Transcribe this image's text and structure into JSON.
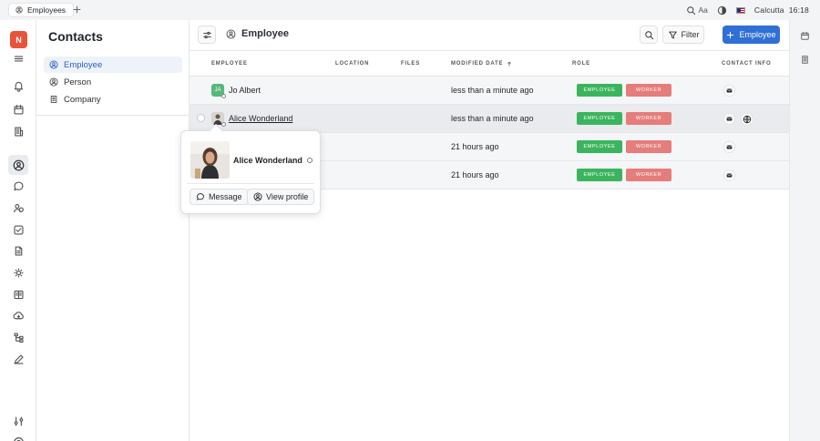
{
  "tabs": [
    {
      "label": "Employees"
    }
  ],
  "topbar": {
    "aa_label": "Aa",
    "location": "Calcutta",
    "time": "16:18"
  },
  "brand": {
    "letter": "N",
    "color": "#e8543a"
  },
  "nav": {
    "title": "Contacts",
    "items": [
      {
        "label": "Employee",
        "icon": "person-circle-icon",
        "active": true
      },
      {
        "label": "Person",
        "icon": "person-circle-icon",
        "active": false
      },
      {
        "label": "Company",
        "icon": "building-icon",
        "active": false
      }
    ]
  },
  "header": {
    "title": "Employee",
    "filter_label": "Filter",
    "new_button_label": "Employee"
  },
  "table": {
    "columns": [
      "Employee",
      "Location",
      "Files",
      "Modified date",
      "Role",
      "Contact info"
    ],
    "rows": [
      {
        "avatar": "JA",
        "name": "Jo Albert",
        "modified": "less than a minute ago",
        "roles": [
          "Employee",
          "Worker"
        ]
      },
      {
        "avatar": "",
        "name": "Alice Wonderland",
        "modified": "less than a minute ago",
        "roles": [
          "Employee",
          "Worker"
        ]
      },
      {
        "avatar": "",
        "name": "",
        "modified": "21 hours ago",
        "roles": [
          "Employee",
          "Worker"
        ]
      },
      {
        "avatar": "",
        "name": "",
        "modified": "21 hours ago",
        "roles": [
          "Employee",
          "Worker"
        ]
      }
    ]
  },
  "popover": {
    "name": "Alice Wonderland",
    "message_label": "Message",
    "view_profile_label": "View profile"
  },
  "colors": {
    "accent": "#2f6fd6",
    "employee_pill": "#3bb55d",
    "worker_pill": "#e57d7b"
  }
}
